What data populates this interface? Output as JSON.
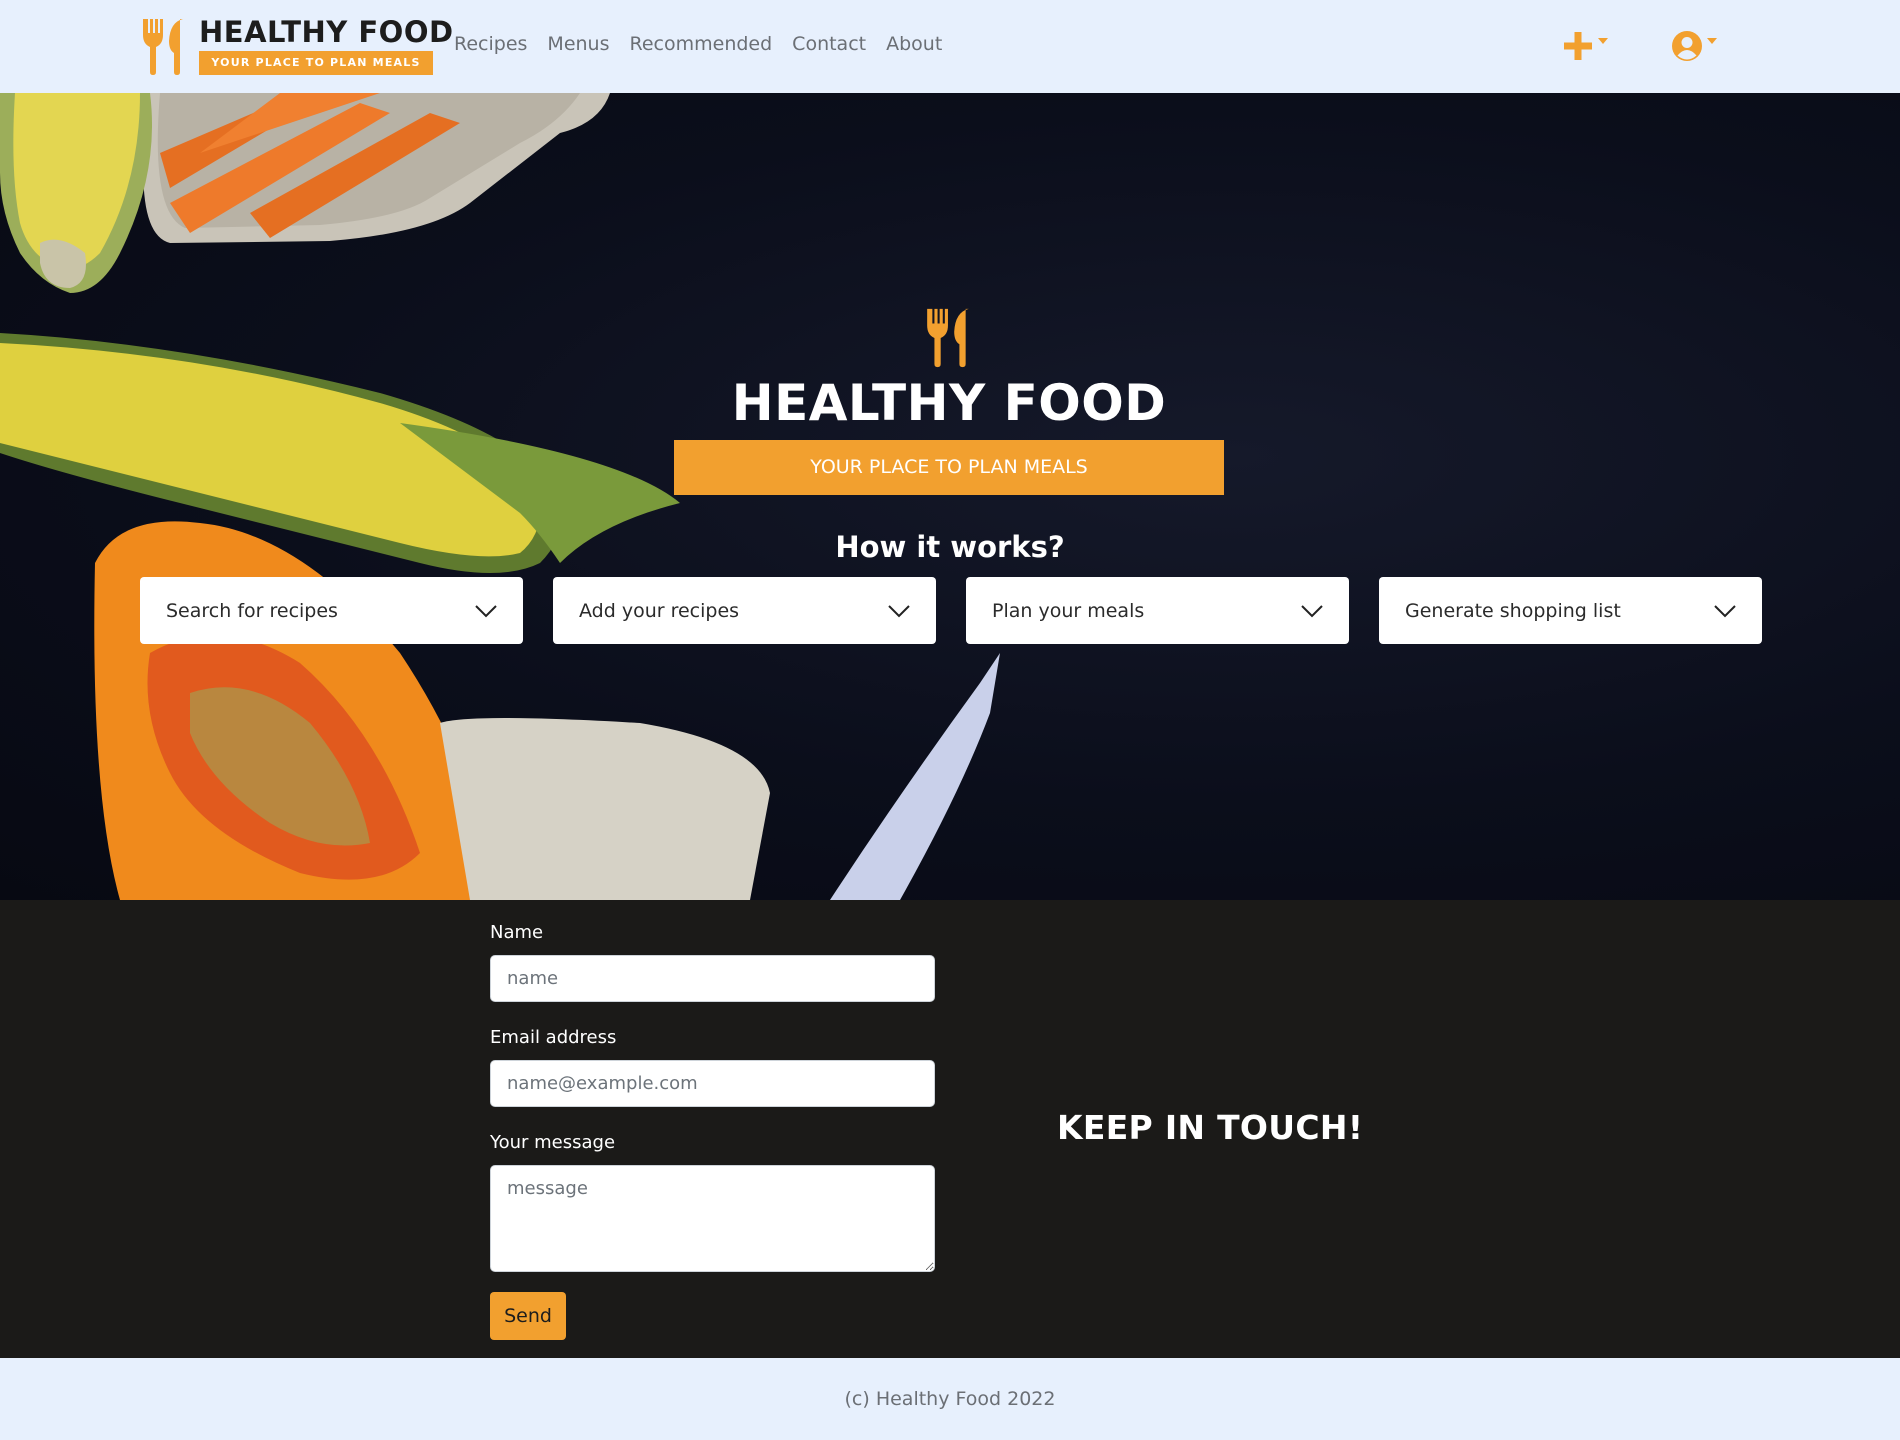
{
  "brand": {
    "title": "HEALTHY FOOD",
    "subtitle": "YOUR PLACE TO PLAN MEALS",
    "logo_icon": "fork-spoon-icon",
    "accent_color": "#f2a02f"
  },
  "nav": {
    "links": [
      "Recipes",
      "Menus",
      "Recommended",
      "Contact",
      "About"
    ],
    "add_icon": "plus-icon",
    "user_icon": "user-circle-icon"
  },
  "hero": {
    "title": "HEALTHY FOOD",
    "tagline": "YOUR PLACE TO PLAN MEALS",
    "how_title": "How it works?",
    "steps": [
      "Search for recipes",
      "Add your recipes",
      "Plan your meals",
      "Generate shopping list"
    ]
  },
  "contact": {
    "name_label": "Name",
    "name_placeholder": "name",
    "email_label": "Email address",
    "email_placeholder": "name@example.com",
    "message_label": "Your message",
    "message_placeholder": "message",
    "send_label": "Send",
    "heading": "KEEP IN TOUCH!"
  },
  "footer": {
    "copyright": "(c) Healthy Food 2022"
  }
}
